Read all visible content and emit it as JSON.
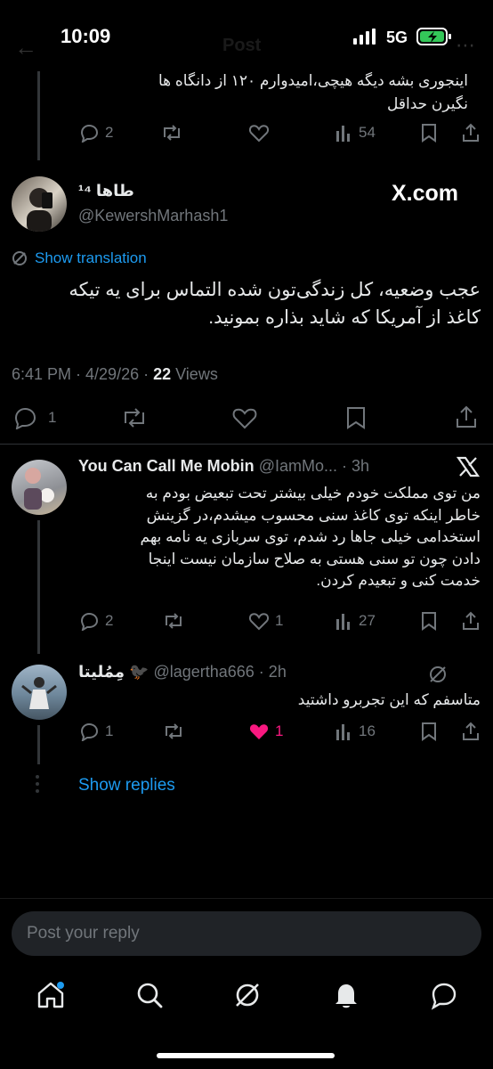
{
  "status_bar": {
    "time": "10:09",
    "network": "5G"
  },
  "header": {
    "title": "Post"
  },
  "prev_reply": {
    "text_lines": [
      "اینجوری بشه دیگه هیچی،امیدوارم ۱۲۰ از دانگاه ها",
      "نگیرن حداقل"
    ],
    "replies": "2",
    "views": "54"
  },
  "main_post": {
    "display_name": "طاها ¹⁴",
    "handle": "@KewershMarhash1",
    "source_logo": "X.com",
    "show_translation": "Show translation",
    "text_lines": [
      "عجب وضعیه، کل زندگی‌تون شده التماس برای یه تیکه",
      "کاغذ از آمریکا که شاید بذاره بمونید."
    ],
    "time_date": "6:41 PM · 4/29/26 · ",
    "views_count": "22",
    "views_label": " Views",
    "replies": "1"
  },
  "reply1": {
    "display_name": "You Can Call Me Mobin",
    "handle_time": "@IamMo... · 3h",
    "text_lines": [
      "من توی مملکت خودم خیلی بیشتر تحت تبعیض بودم به",
      "خاطر اینکه توی کاغذ سنی محسوب میشدم،در گزینش",
      "استخدامی خیلی جاها رد شدم، توی سربازی یه نامه بهم",
      "دادن چون تو سنی هستی به صلاح سازمان نیست اینجا",
      "خدمت کنی و تبعیدم کردن."
    ],
    "replies": "2",
    "likes": "1",
    "views": "27"
  },
  "reply2": {
    "display_name": "مِمُلیتا 🐦‍⬛",
    "handle_time": "@lagertha666 · 2h",
    "text": "متاسفم که این تجربرو داشتید",
    "replies": "1",
    "likes": "1",
    "views": "16"
  },
  "show_replies": "Show replies",
  "composer": {
    "placeholder": "Post your reply"
  },
  "colors": {
    "accent": "#1d9bf0",
    "like": "#f91880",
    "muted": "#71767b"
  },
  "bottom_nav": [
    "home-icon",
    "search-icon",
    "grok-icon",
    "notifications-icon",
    "messages-icon"
  ]
}
